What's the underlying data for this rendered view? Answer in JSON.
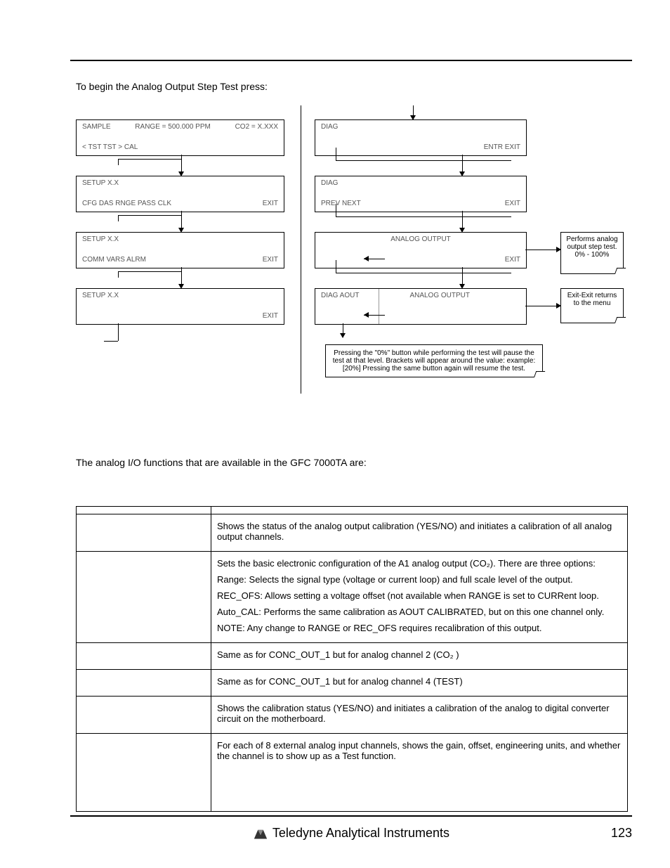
{
  "intro": "To begin the Analog Output Step Test press:",
  "screens_left": [
    {
      "top_left": "SAMPLE",
      "top_center": "RANGE = 500.000 PPM",
      "top_right": "CO2 = X.XXX",
      "bottom_left": "< TST  TST >  CAL",
      "bottom_right": ""
    },
    {
      "top_left": "SETUP X.X",
      "top_center": "",
      "top_right": "",
      "bottom_left": "CFG  DAS  RNGE  PASS  CLK",
      "bottom_right": "EXIT"
    },
    {
      "top_left": "SETUP X.X",
      "top_center": "",
      "top_right": "",
      "bottom_left": "COMM  VARS        ALRM",
      "bottom_right": "EXIT"
    },
    {
      "top_left": "SETUP X.X",
      "top_center": "",
      "top_right": "",
      "bottom_left": "",
      "bottom_right": "EXIT"
    }
  ],
  "screens_right": [
    {
      "top_left": "DIAG",
      "top_center": "",
      "top_right": "",
      "bottom_left": "",
      "bottom_right": "ENTR  EXIT"
    },
    {
      "top_left": "DIAG",
      "top_center": "",
      "top_right": "",
      "bottom_left": "PREV    NEXT",
      "bottom_right": "EXIT"
    },
    {
      "top_left": "",
      "top_center": "ANALOG OUTPUT",
      "top_right": "",
      "bottom_left": "",
      "bottom_right": "EXIT"
    },
    {
      "top_left": "DIAG AOUT",
      "top_center": "ANALOG OUTPUT",
      "top_right": "",
      "bottom_left": "",
      "bottom_right": ""
    }
  ],
  "note1": "Performs analog output step test.\n0% - 100%",
  "note2": "Exit-Exit returns to the menu",
  "pause_note": "Pressing the \"0%\" button while performing the test will pause the test at that level. Brackets will appear around the value: example: [20%] Pressing the same button again will resume the test.",
  "body_line": "The analog I/O functions that are available in the GFC 7000TA are:",
  "table": {
    "rows": [
      {
        "desc_lines": [
          "Shows the status of the analog output calibration (YES/NO) and initiates a calibration of all analog output channels."
        ]
      },
      {
        "desc_lines": [
          "Sets the basic electronic configuration of the A1 analog output (CO₂). There are three options:",
          "Range: Selects the signal type (voltage or current loop) and full scale level of the output.",
          "REC_OFS: Allows setting a voltage offset (not available when RANGE is set to CURRent loop.",
          "Auto_CAL: Performs the same calibration as AOUT CALIBRATED, but on this one channel only.",
          "NOTE: Any change to RANGE or REC_OFS requires recalibration of this output."
        ]
      },
      {
        "desc_lines": [
          "Same as for CONC_OUT_1 but for analog channel 2 (CO₂ )"
        ]
      },
      {
        "desc_lines": [
          "Same as for CONC_OUT_1 but for analog channel 4 (TEST)"
        ]
      },
      {
        "desc_lines": [
          "Shows the calibration status (YES/NO) and initiates a calibration of the analog to digital converter circuit on the motherboard."
        ]
      },
      {
        "desc_lines": [
          "For each of 8 external analog input channels, shows the gain, offset, engineering units, and whether the channel is to show up as a Test function."
        ]
      }
    ]
  },
  "footer": {
    "brand": "Teledyne Analytical Instruments",
    "page": "123"
  }
}
